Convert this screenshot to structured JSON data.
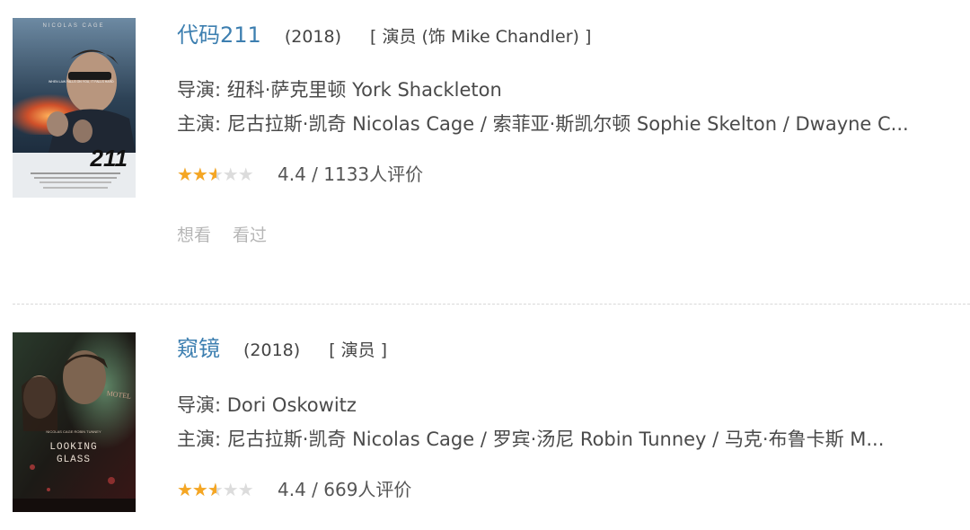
{
  "movies": [
    {
      "title": "代码211",
      "year": "(2018)",
      "role": "[ 演员 (饰 Mike Chandler) ]",
      "director": "导演: 纽科·萨克里顿 York Shackleton",
      "cast": "主演: 尼古拉斯·凯奇 Nicolas Cage / 索菲亚·斯凯尔顿 Sophie Skelton / Dwayne C...",
      "rating_text": "4.4 / 1133人评价",
      "rating_stars": 2.2,
      "actions": {
        "want": "想看",
        "seen": "看过"
      },
      "poster": {
        "top_text": "NICOLAS CAGE",
        "big_text": "211",
        "tagline": "WHEN LAW FALLS ON YOU, IT FALLS HARD"
      }
    },
    {
      "title": "窥镜",
      "year": "(2018)",
      "role": "[ 演员 ]",
      "director": "导演: Dori Oskowitz",
      "cast": "主演: 尼古拉斯·凯奇 Nicolas Cage / 罗宾·汤尼 Robin Tunney / 马克·布鲁卡斯 M...",
      "rating_text": "4.4 / 669人评价",
      "rating_stars": 2.2,
      "poster": {
        "top_text": "NICOLAS CAGE  ROBIN TUNNEY",
        "big_text_1": "LOOKING",
        "big_text_2": "GLASS",
        "sign_text": "MOTEL"
      }
    }
  ],
  "colors": {
    "link": "#3d7fb0",
    "star": "#f5a623",
    "star_empty": "#dcdcdc"
  }
}
